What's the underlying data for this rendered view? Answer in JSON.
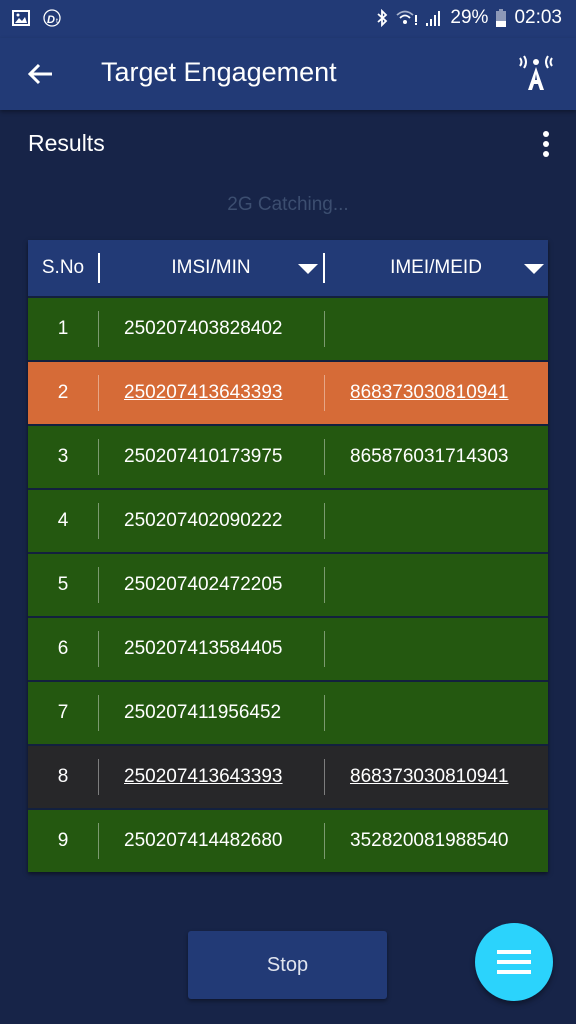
{
  "status_bar": {
    "left_icons": [
      "gallery-icon",
      "dt-app-icon"
    ],
    "right_icons": [
      "bluetooth-icon",
      "wifi-icon",
      "signal-icon",
      "battery-icon"
    ],
    "battery": "29%",
    "time": "02:03"
  },
  "app_bar": {
    "title": "Target Engagement",
    "back_icon": "arrow-left-icon",
    "action_icon": "antenna-tower-icon"
  },
  "section": {
    "title": "Results",
    "status_text": "2G Catching..."
  },
  "table": {
    "headers": [
      "S.No",
      "IMSI/MIN",
      "IMEI/MEID"
    ],
    "rows": [
      {
        "sno": "1",
        "imsi": "250207403828402",
        "imei": "",
        "state": "normal"
      },
      {
        "sno": "2",
        "imsi": "250207413643393",
        "imei": "868373030810941",
        "state": "selected"
      },
      {
        "sno": "3",
        "imsi": "250207410173975",
        "imei": "865876031714303",
        "state": "normal"
      },
      {
        "sno": "4",
        "imsi": "250207402090222",
        "imei": "",
        "state": "normal"
      },
      {
        "sno": "5",
        "imsi": "250207402472205",
        "imei": "",
        "state": "normal"
      },
      {
        "sno": "6",
        "imsi": "250207413584405",
        "imei": "",
        "state": "normal"
      },
      {
        "sno": "7",
        "imsi": "250207411956452",
        "imei": "",
        "state": "normal"
      },
      {
        "sno": "8",
        "imsi": "250207413643393",
        "imei": "868373030810941",
        "state": "duplicate"
      },
      {
        "sno": "9",
        "imsi": "250207414482680",
        "imei": "352820081988540",
        "state": "normal"
      }
    ]
  },
  "colors": {
    "appbar": "#223a76",
    "background": "#172448",
    "row_normal": "#245810",
    "row_selected": "#d66b37",
    "row_duplicate": "#272729",
    "fab": "#2bd3fc"
  },
  "buttons": {
    "stop": "Stop",
    "fab_icon": "menu-icon"
  }
}
